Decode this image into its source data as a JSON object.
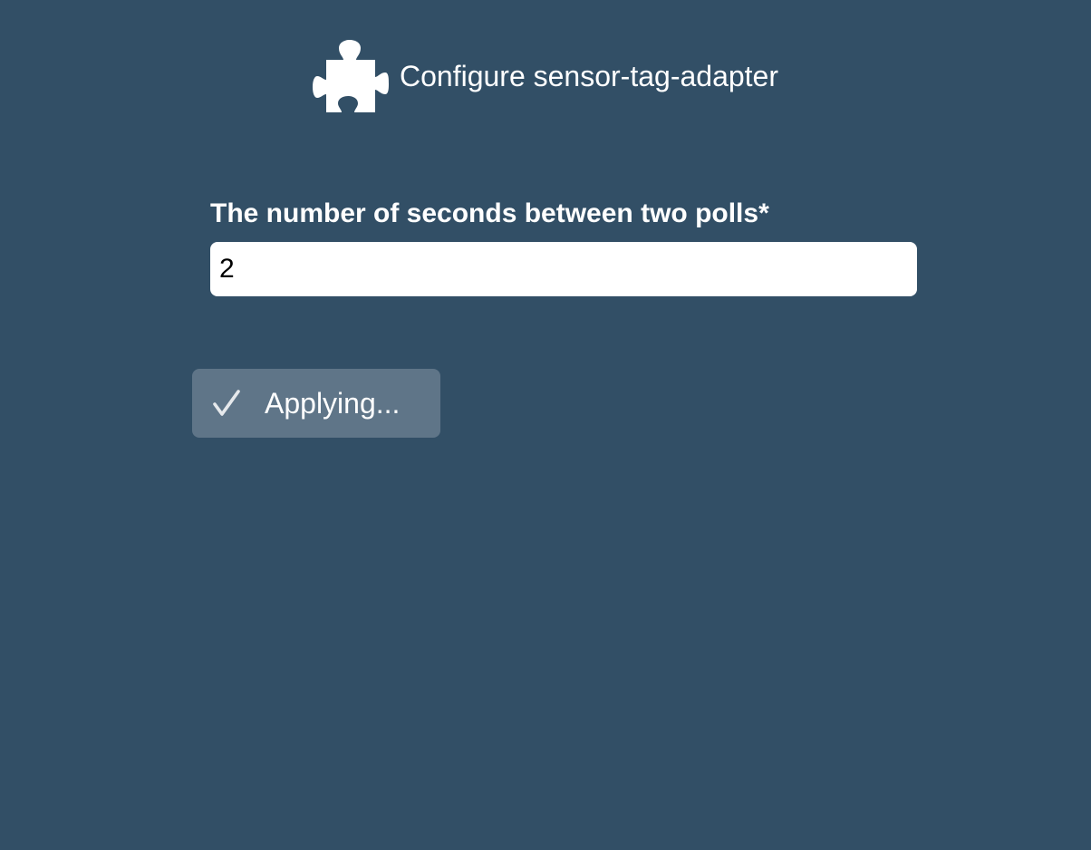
{
  "header": {
    "icon": "puzzle-piece-icon",
    "title": "Configure sensor-tag-adapter"
  },
  "form": {
    "fields": [
      {
        "label": "The number of seconds between two polls*",
        "value": "2"
      }
    ]
  },
  "apply_button": {
    "icon": "checkmark-icon",
    "label": "Applying..."
  },
  "colors": {
    "background": "#324f66",
    "button_background": "#5f7588",
    "text": "#ffffff",
    "input_background": "#ffffff"
  }
}
